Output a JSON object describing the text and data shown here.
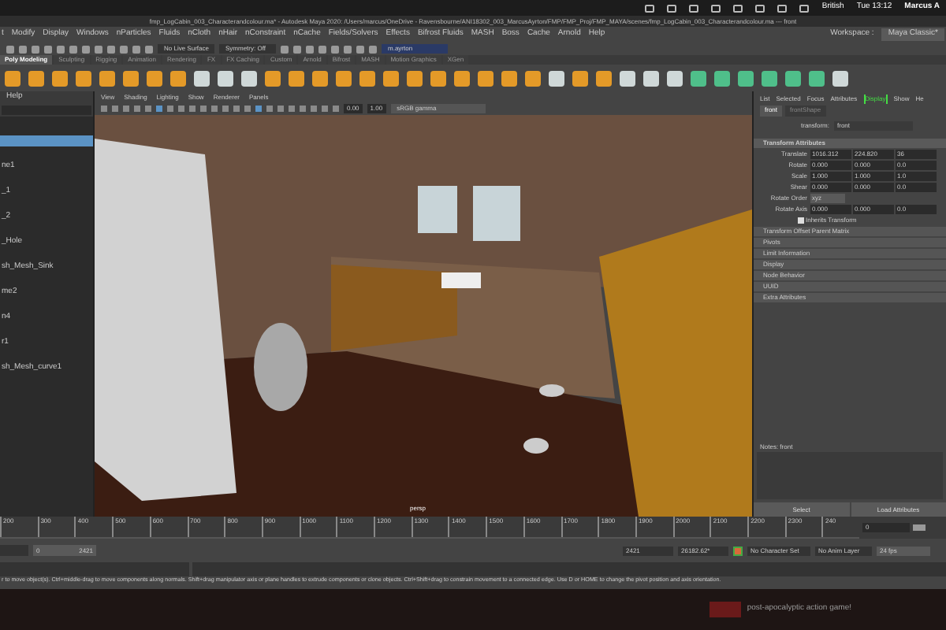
{
  "mac_menubar": {
    "language": "British",
    "clock": "Tue 13:12",
    "user": "Marcus A"
  },
  "title_bar": {
    "title": "fmp_LogCabin_003_Characterandcolour.ma* - Autodesk Maya 2020: /Users/marcus/OneDrive - Ravensbourne/ANI18302_003_MarcusAyrton/FMP/FMP_Proj/FMP_MAYA/scenes/fmp_LogCabin_003_Characterandcolour.ma  ---  front"
  },
  "menu_bar": {
    "items": [
      "t",
      "Modify",
      "Display",
      "Windows",
      "nParticles",
      "Fluids",
      "nCloth",
      "nHair",
      "nConstraint",
      "nCache",
      "Fields/Solvers",
      "Effects",
      "Bifrost Fluids",
      "MASH",
      "Boss",
      "Cache",
      "Arnold",
      "Help"
    ],
    "workspace_label": "Workspace :",
    "workspace": "Maya Classic*"
  },
  "status_line": {
    "live_surface": "No Live Surface",
    "symmetry": "Symmetry: Off",
    "user": "m.ayrton"
  },
  "shelf_tabs": [
    {
      "label": "Poly Modeling",
      "selected": true
    },
    {
      "label": "Sculpting",
      "selected": false
    },
    {
      "label": "Rigging",
      "selected": false
    },
    {
      "label": "Animation",
      "selected": false
    },
    {
      "label": "Rendering",
      "selected": false
    },
    {
      "label": "FX",
      "selected": false
    },
    {
      "label": "FX Caching",
      "selected": false
    },
    {
      "label": "Custom",
      "selected": false
    },
    {
      "label": "Arnold",
      "selected": false
    },
    {
      "label": "Bifrost",
      "selected": false
    },
    {
      "label": "MASH",
      "selected": false
    },
    {
      "label": "Motion Graphics",
      "selected": false
    },
    {
      "label": "XGen",
      "selected": false
    }
  ],
  "outliner": {
    "menu": "Help",
    "items": [
      {
        "selected": true
      },
      {
        "label": "ne1",
        "selected": false
      },
      {
        "label": "_1",
        "selected": false
      },
      {
        "label": "_2",
        "selected": false
      },
      {
        "label": "_Hole",
        "selected": false
      },
      {
        "label": "sh_Mesh_Sink",
        "selected": false
      },
      {
        "label": "me2",
        "selected": false
      },
      {
        "label": "n4",
        "selected": false
      },
      {
        "label": "r1",
        "selected": false
      },
      {
        "label": "sh_Mesh_curve1",
        "selected": false
      }
    ]
  },
  "viewport": {
    "menus": [
      "View",
      "Shading",
      "Lighting",
      "Show",
      "Renderer",
      "Panels"
    ],
    "exposure": "0.00",
    "gamma": "1.00",
    "color_space": "sRGB gamma",
    "camera": "persp"
  },
  "attribute_editor": {
    "menus": [
      {
        "label": "List",
        "selected": false
      },
      {
        "label": "Selected",
        "selected": false
      },
      {
        "label": "Focus",
        "selected": false
      },
      {
        "label": "Attributes",
        "selected": false
      },
      {
        "label": "Display",
        "selected": true
      },
      {
        "label": "Show",
        "selected": false
      },
      {
        "label": "He",
        "selected": false
      }
    ],
    "tabs": [
      {
        "label": "front",
        "selected": true
      },
      {
        "label": "frontShape",
        "selected": false
      }
    ],
    "transform_label": "transform:",
    "transform_value": "front",
    "section": "Transform Attributes",
    "rows": [
      {
        "kind": "vector",
        "label": "Translate",
        "values": [
          "1016.312",
          "224.820",
          "36"
        ]
      },
      {
        "kind": "vector",
        "label": "Rotate",
        "values": [
          "0.000",
          "0.000",
          "0.0"
        ]
      },
      {
        "kind": "vector",
        "label": "Scale",
        "values": [
          "1.000",
          "1.000",
          "1.0"
        ]
      },
      {
        "kind": "vector",
        "label": "Shear",
        "values": [
          "0.000",
          "0.000",
          "0.0"
        ]
      },
      {
        "kind": "dropdown",
        "label": "Rotate Order",
        "value": "xyz"
      },
      {
        "kind": "vector",
        "label": "Rotate Axis",
        "values": [
          "0.000",
          "0.000",
          "0.0"
        ]
      }
    ],
    "inherits": {
      "label": "Inherits Transform",
      "checked": true
    },
    "sections": [
      "Transform Offset Parent Matrix",
      "Pivots",
      "Limit Information",
      "Display",
      "Node Behavior",
      "UUID",
      "Extra Attributes"
    ],
    "notes": "Notes:  front",
    "buttons": [
      "Select",
      "Load Attributes"
    ]
  },
  "timeline": {
    "ticks": [
      "200",
      "300",
      "400",
      "500",
      "600",
      "700",
      "800",
      "900",
      "1000",
      "1100",
      "1200",
      "1300",
      "1400",
      "1500",
      "1600",
      "1700",
      "1800",
      "1900",
      "2000",
      "2100",
      "2200",
      "2300",
      "240"
    ],
    "current_frame": "0"
  },
  "range": {
    "level": 1,
    "start": "0",
    "end": "2421",
    "end_field": "2421",
    "current": "26182.62*",
    "character_set": "No Character Set",
    "anim_layer": "No Anim Layer",
    "fps": "24 fps"
  },
  "help_line": "r to move object(s). Ctrl+middle-drag to move components along normals. Shift+drag manipulator axis or plane handles to extrude components or clone objects. Ctrl+Shift+drag to constrain movement to a connected edge. Use D or HOME to change the pivot position and axis orientation.",
  "desktop_caption": "post-apocalyptic action game!"
}
